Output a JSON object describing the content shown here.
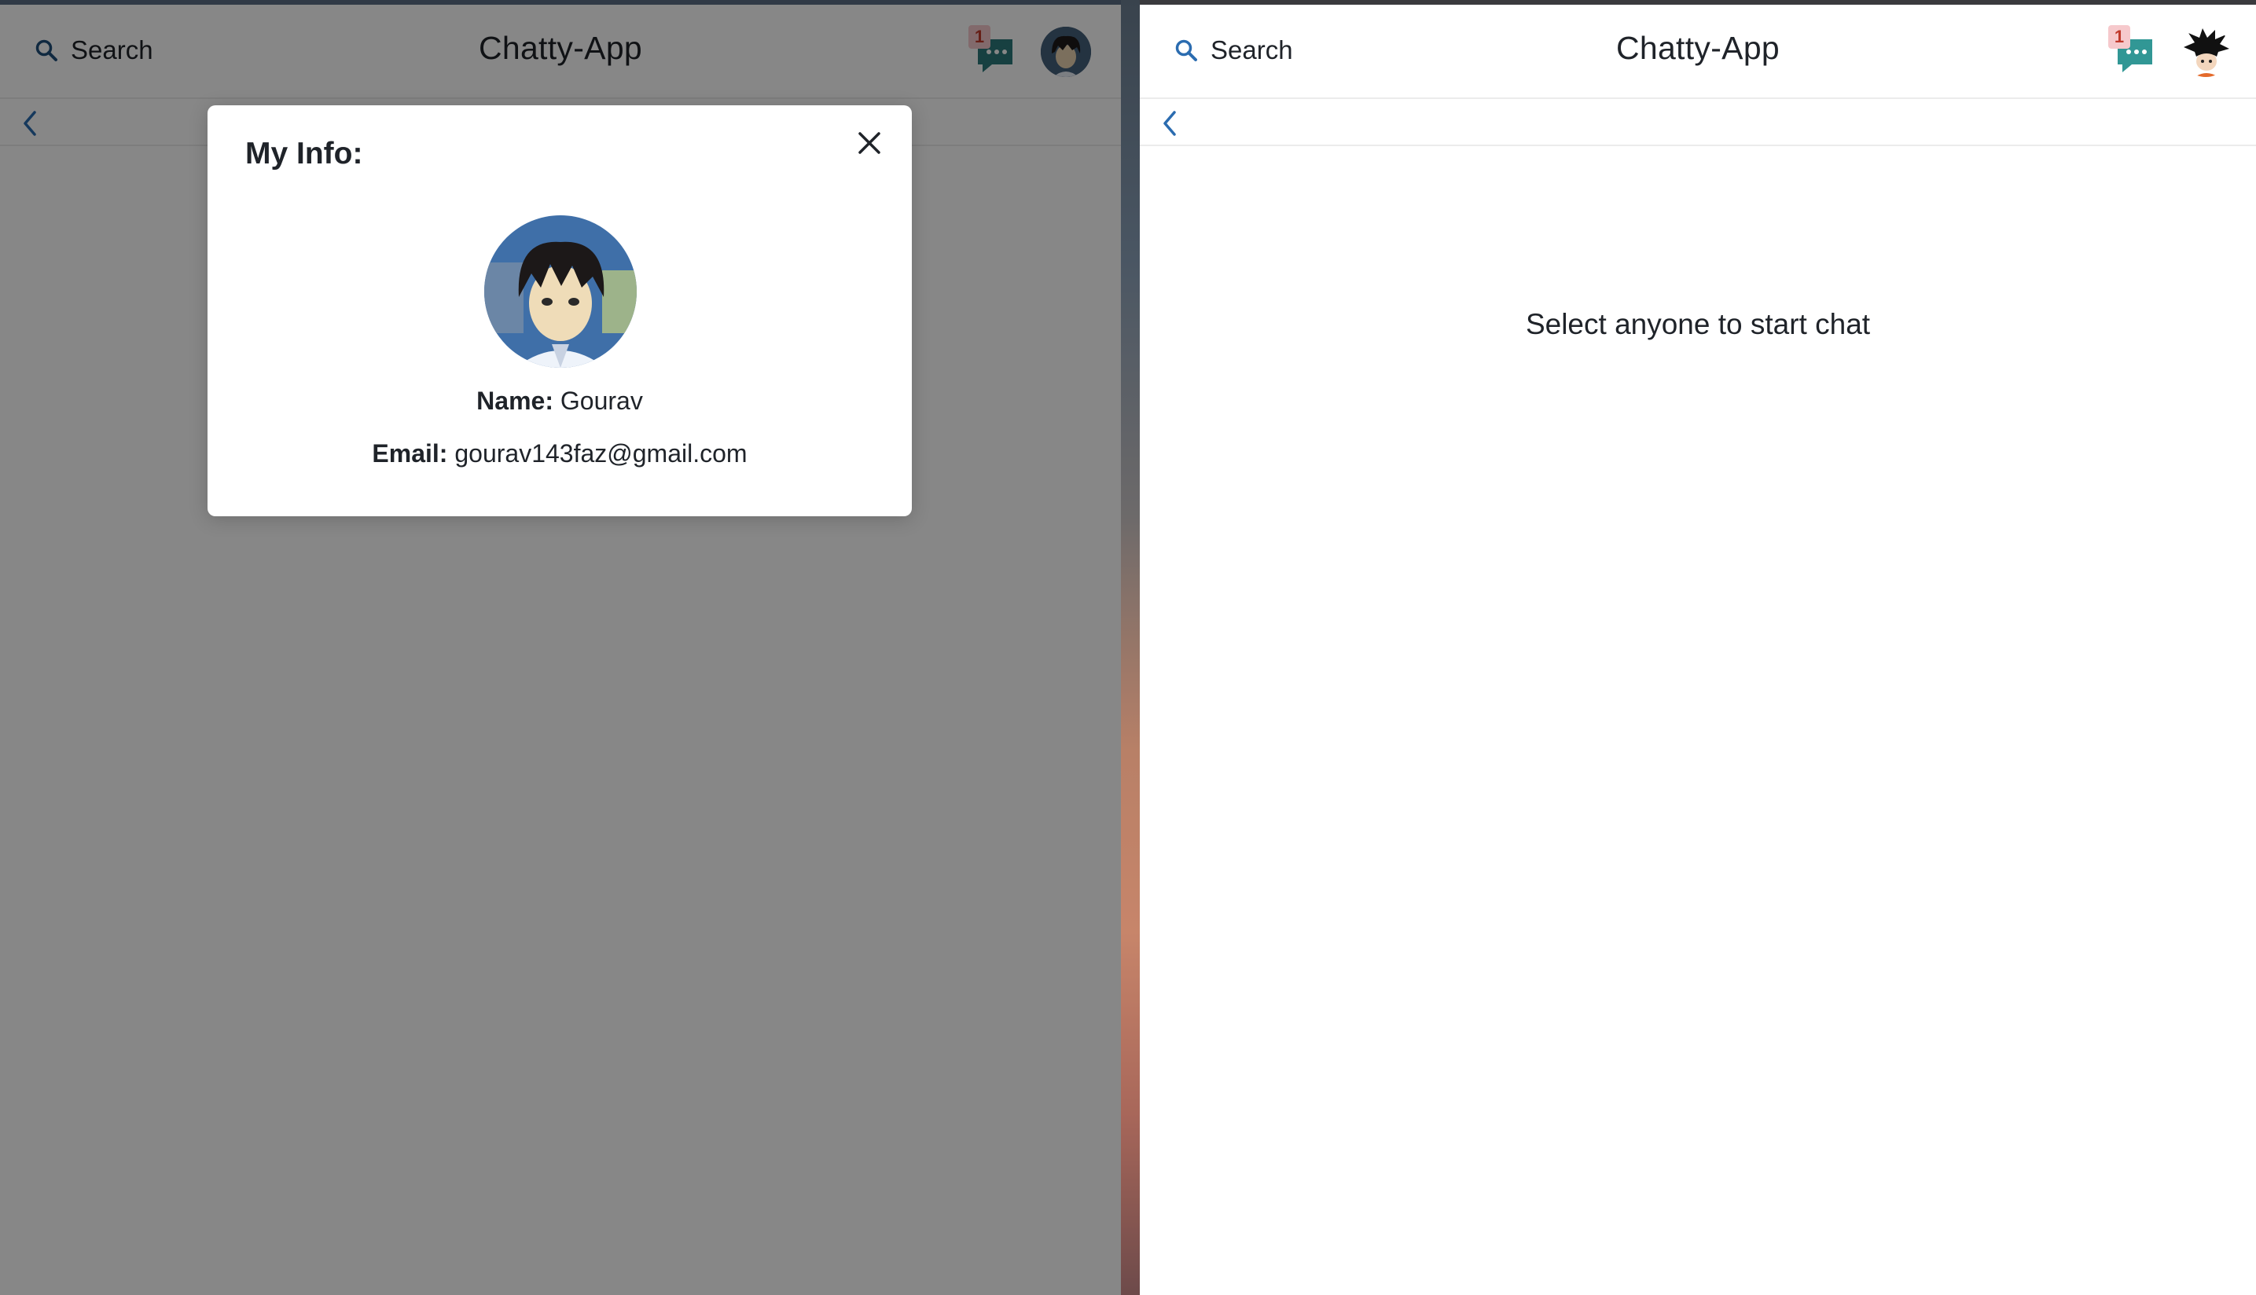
{
  "left_window": {
    "header": {
      "search_label": "Search",
      "title": "Chatty-App",
      "notification_count": "1"
    },
    "modal": {
      "title": "My Info:",
      "name_label": "Name:",
      "name_value": "Gourav",
      "email_label": "Email:",
      "email_value": "gourav143faz@gmail.com"
    }
  },
  "right_window": {
    "header": {
      "search_label": "Search",
      "title": "Chatty-App",
      "notification_count": "1"
    },
    "empty_state": "Select anyone to start chat"
  },
  "colors": {
    "accent_blue": "#2b6cb0",
    "chat_icon_teal": "#2c7a7b",
    "overlay": "rgba(0,0,0,0.47)"
  },
  "icons": [
    "search-icon",
    "chat-icon",
    "back-chevron-icon",
    "close-icon",
    "avatar"
  ]
}
